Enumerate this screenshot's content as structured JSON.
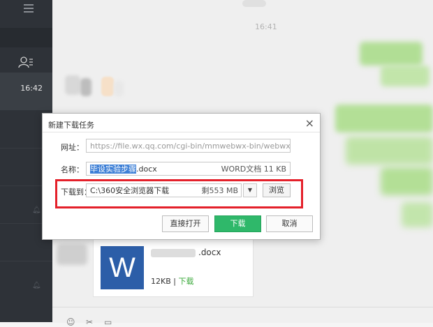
{
  "sidebar": {
    "chat_time": "16:42"
  },
  "chat": {
    "timestamp": "16:41"
  },
  "file_card": {
    "name_suffix": ".docx",
    "word_letter": "W",
    "size": "12KB",
    "separator": "|",
    "download_link": "下载"
  },
  "dialog": {
    "title": "新建下载任务",
    "close_symbol": "×",
    "url_label": "网址：",
    "url_value": "https://file.wx.qq.com/cgi-bin/mmwebwx-bin/webwxgetme",
    "name_label": "名称：",
    "name_selected": "毕设实验步骤",
    "name_rest": ".docx",
    "file_meta": "WORD文档 11 KB",
    "path_label": "下载到：",
    "path_value": "C:\\360安全浏览器下载",
    "free_space": "剩553 MB",
    "dropdown_symbol": "▼",
    "browse_label": "浏览",
    "open_label": "直接打开",
    "download_label": "下载",
    "cancel_label": "取消"
  },
  "colors": {
    "sidebar": "#2e3238",
    "accent_green": "#2fb86a",
    "highlight_red": "#e4202a",
    "word_blue": "#2c5ea8"
  }
}
